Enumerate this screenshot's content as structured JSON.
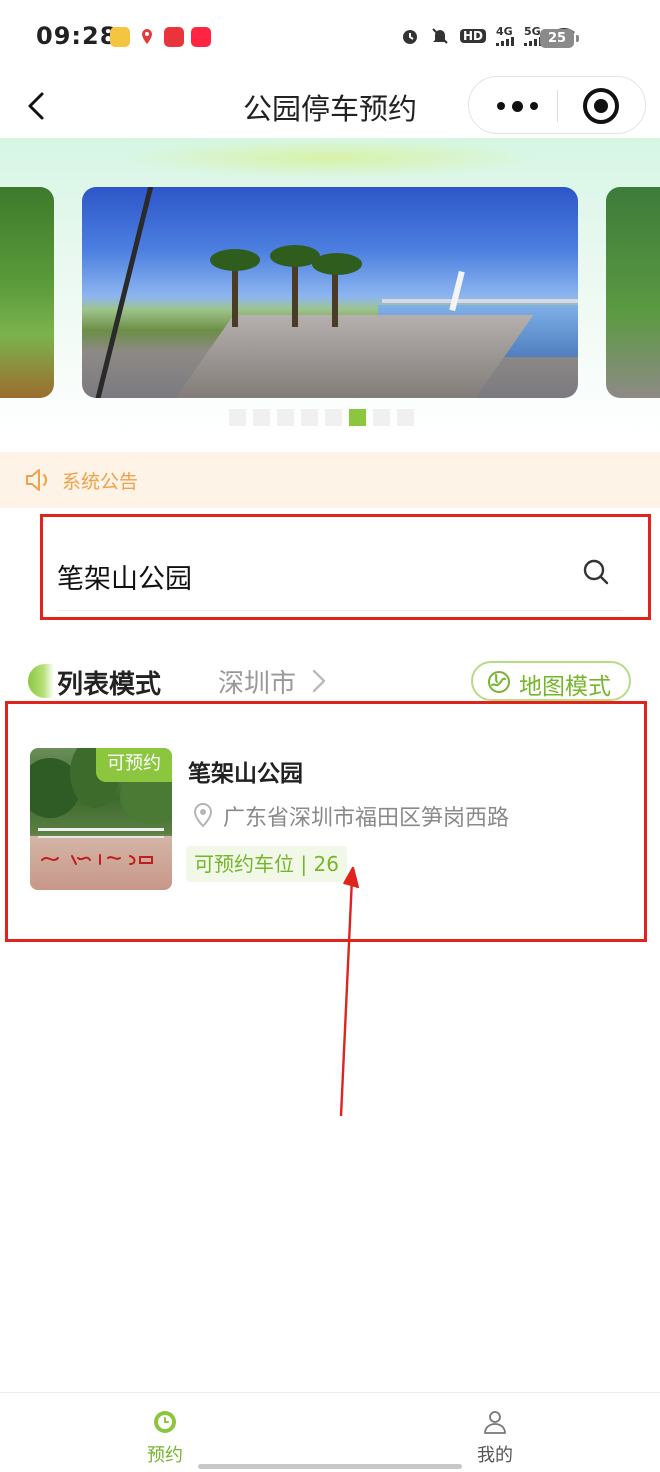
{
  "status_bar": {
    "time": "09:28",
    "network": [
      "HD",
      "4G",
      "5G"
    ],
    "battery": "25"
  },
  "nav": {
    "title": "公园停车预约"
  },
  "banner": {
    "dot_count": 8,
    "active_index": 5
  },
  "notice": {
    "label": "系统公告"
  },
  "search": {
    "value": "笔架山公园"
  },
  "mode_row": {
    "list_mode_label": "列表模式",
    "city": "深圳市",
    "map_mode_label": "地图模式"
  },
  "park": {
    "badge": "可预约",
    "name": "笔架山公园",
    "address": "广东省深圳市福田区笋岗西路",
    "spaces_label": "可预约车位",
    "spaces_count": "26"
  },
  "tabbar": {
    "tabs": [
      {
        "label": "预约",
        "icon": "clock-icon"
      },
      {
        "label": "我的",
        "icon": "user-icon"
      }
    ]
  },
  "colors": {
    "accent": "#8cc63f",
    "accent_text": "#76b52c",
    "notice_bg": "#fdf3e7",
    "notice_text": "#f0a24a",
    "annotation": "#e0231c"
  }
}
